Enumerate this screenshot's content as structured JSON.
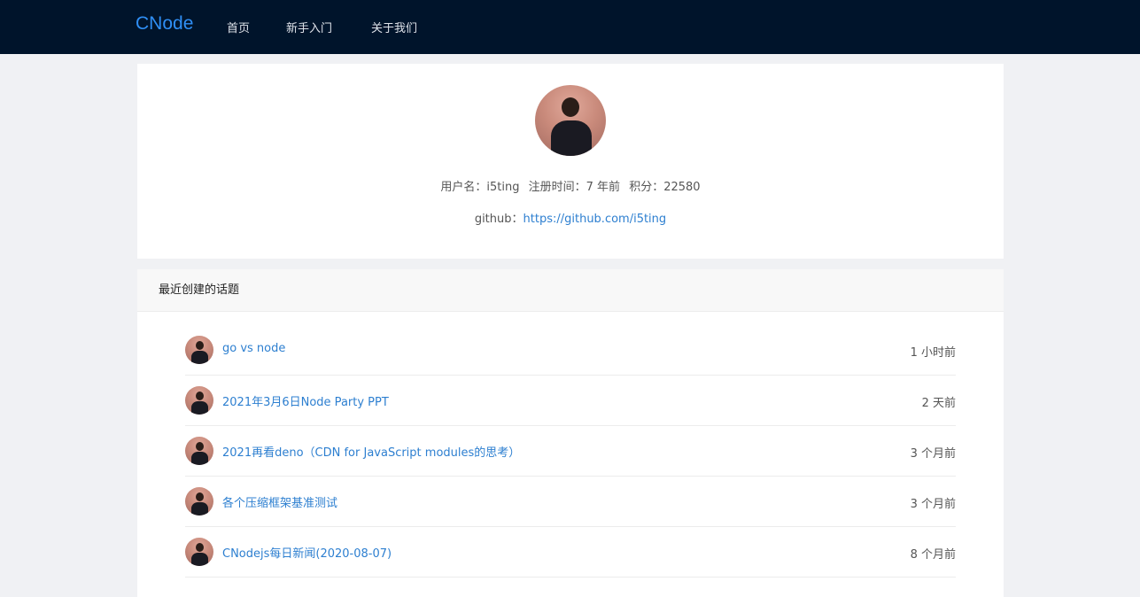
{
  "nav": {
    "brand": "CNode",
    "items": [
      {
        "label": "首页"
      },
      {
        "label": "新手入门"
      },
      {
        "label": "关于我们"
      }
    ]
  },
  "profile": {
    "username_label": "用户名：i5ting",
    "register_label": "注册时间：7 年前",
    "score_label": "积分：22580",
    "github_label": "github：",
    "github_url": "https://github.com/i5ting"
  },
  "topics": {
    "header": "最近创建的话题",
    "items": [
      {
        "title": "go vs node",
        "time": "1 小时前"
      },
      {
        "title": "2021年3月6日Node Party PPT",
        "time": "2 天前"
      },
      {
        "title": "2021再看deno（CDN for JavaScript modules的思考）",
        "time": "3 个月前"
      },
      {
        "title": "各个压缩框架基准测试",
        "time": "3 个月前"
      },
      {
        "title": "CNodejs每日新闻(2020-08-07)",
        "time": "8 个月前"
      }
    ]
  }
}
